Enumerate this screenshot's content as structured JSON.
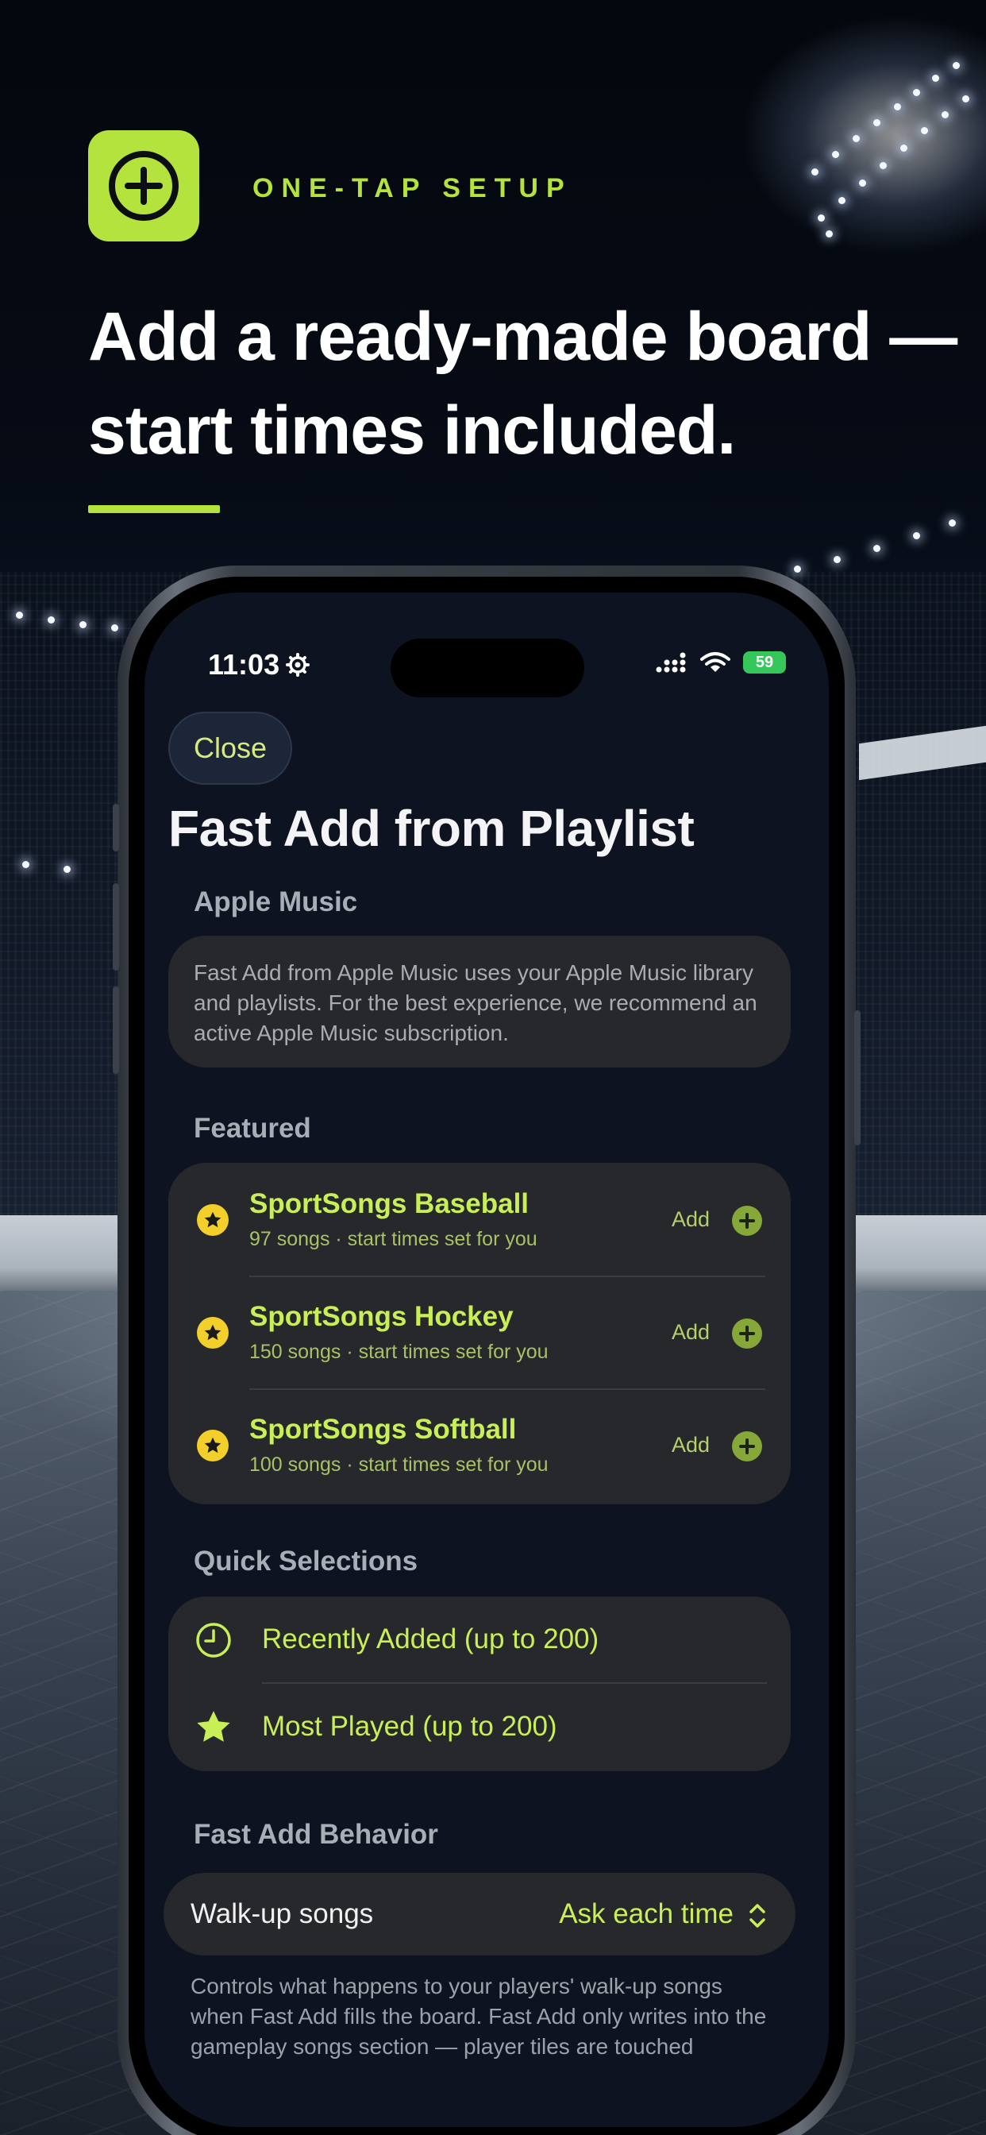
{
  "promo": {
    "badge_icon": "plus-circle-icon",
    "eyebrow": "ONE-TAP SETUP",
    "headline": "Add a ready-made board — start times included.",
    "accent_color": "#b4e33d"
  },
  "status_bar": {
    "time": "11:03",
    "battery": "59"
  },
  "sheet": {
    "close_label": "Close",
    "title": "Fast Add from Playlist",
    "apple_music": {
      "label": "Apple Music",
      "description": "Fast Add from Apple Music uses your Apple Music library and playlists. For the best experience, we recommend an active Apple Music subscription."
    },
    "featured": {
      "label": "Featured",
      "items": [
        {
          "title": "SportSongs Baseball",
          "subtitle": "97 songs · start times set for you",
          "add_label": "Add"
        },
        {
          "title": "SportSongs Hockey",
          "subtitle": "150 songs · start times set for you",
          "add_label": "Add"
        },
        {
          "title": "SportSongs Softball",
          "subtitle": "100 songs · start times set for you",
          "add_label": "Add"
        }
      ]
    },
    "quick": {
      "label": "Quick Selections",
      "items": [
        {
          "icon": "clock-icon",
          "label": "Recently Added (up to 200)"
        },
        {
          "icon": "star-icon",
          "label": "Most Played (up to 200)"
        }
      ]
    },
    "behavior": {
      "label": "Fast Add Behavior",
      "walkup_label": "Walk-up songs",
      "walkup_value": "Ask each time",
      "footnote": "Controls what happens to your players' walk-up songs when Fast Add fills the board. Fast Add only writes into the gameplay songs section — player tiles are touched"
    }
  }
}
